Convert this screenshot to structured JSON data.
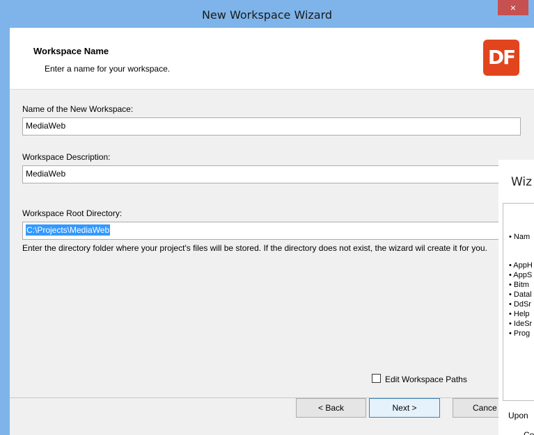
{
  "window": {
    "title": "New Workspace Wizard",
    "close_label": "×"
  },
  "header": {
    "title": "Workspace Name",
    "subtitle": "Enter a name for your workspace.",
    "logo_text": "DF"
  },
  "form": {
    "name_label": "Name of the New Workspace:",
    "name_value": "MediaWeb",
    "desc_label": "Workspace Description:",
    "desc_value": "MediaWeb",
    "root_label": "Workspace Root Directory:",
    "root_value": "C:\\Projects\\MediaWeb",
    "help_text": "Enter the directory folder where your project's files will be stored. If the directory does not exist, the wizard wil create it for you.",
    "edit_paths_label": "Edit Workspace Paths"
  },
  "buttons": {
    "back": "< Back",
    "next": "Next >",
    "cancel": "Cance"
  },
  "second_window": {
    "title": "Wiz",
    "lines": [
      "• Nam",
      "• AppH",
      "• AppS",
      "• Bitm",
      "• Datal",
      "• DdSr",
      "• Help",
      "• IdeSr",
      "• Prog"
    ],
    "footer_1": "Upon",
    "footer_2": "Co"
  },
  "colors": {
    "title_bar": "#7eb4ea",
    "close_button": "#c75050",
    "logo": "#e2441d",
    "selection": "#3399ff"
  }
}
